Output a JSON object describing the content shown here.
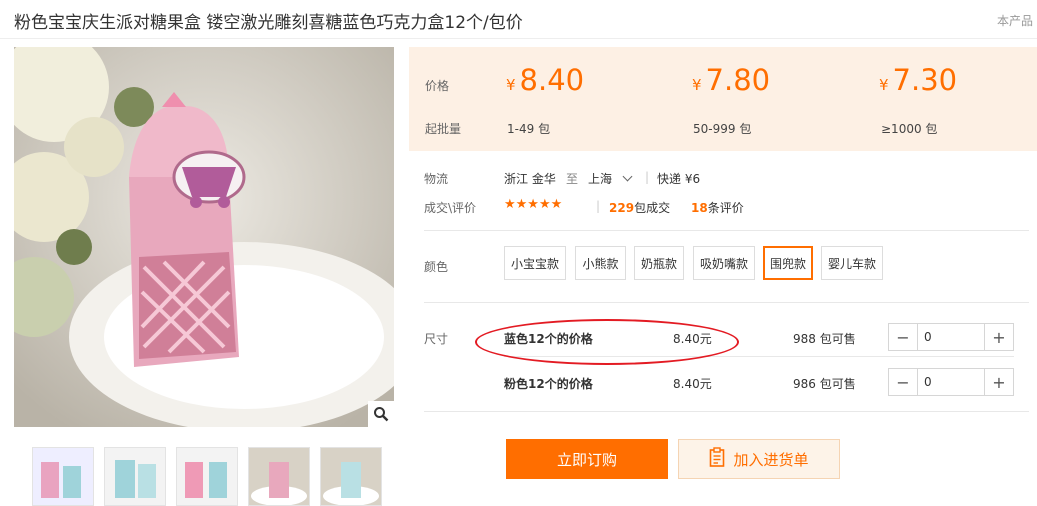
{
  "product": {
    "title": "粉色宝宝庆生派对糖果盒 镂空激光雕刻喜糖蓝色巧克力盒12个/包价",
    "corner_note": "本产品"
  },
  "prices": {
    "label_price": "价格",
    "label_moq": "起批量",
    "currency": "¥",
    "tiers": [
      {
        "price": "8.40",
        "qty": "1-49",
        "unit": "包"
      },
      {
        "price": "7.80",
        "qty": "50-999",
        "unit": "包"
      },
      {
        "price": "7.30",
        "qty": "≥1000",
        "unit": "包"
      }
    ]
  },
  "logistics": {
    "label": "物流",
    "origin": "浙江 金华",
    "to": "至",
    "destination": "上海",
    "express": "快递 ¥6"
  },
  "trades": {
    "label": "成交\\评价",
    "stars": "★★★★★",
    "deal_count": "229",
    "deal_suffix": "包成交",
    "review_count": "18",
    "review_suffix": "条评价"
  },
  "colors": {
    "label": "颜色",
    "options": [
      "小宝宝款",
      "小熊款",
      "奶瓶款",
      "吸奶嘴款",
      "围兜款",
      "婴儿车款"
    ],
    "selected": "围兜款"
  },
  "sizes": {
    "label": "尺寸",
    "rows": [
      {
        "name": "蓝色12个的价格",
        "price": "8.40元",
        "stock": "988 包可售",
        "qty": "0"
      },
      {
        "name": "粉色12个的价格",
        "price": "8.40元",
        "stock": "986 包可售",
        "qty": "0"
      }
    ],
    "minus": "−",
    "plus": "+"
  },
  "actions": {
    "buy": "立即订购",
    "cart": "加入进货单"
  },
  "icons": {
    "zoom": "magnifier-icon",
    "dropdown": "chevron-down-icon",
    "cart": "clipboard-icon"
  },
  "colors_theme": {
    "accent": "#ff6e00",
    "price_bg": "#fdf0e4",
    "annotation": "#e31b23"
  }
}
